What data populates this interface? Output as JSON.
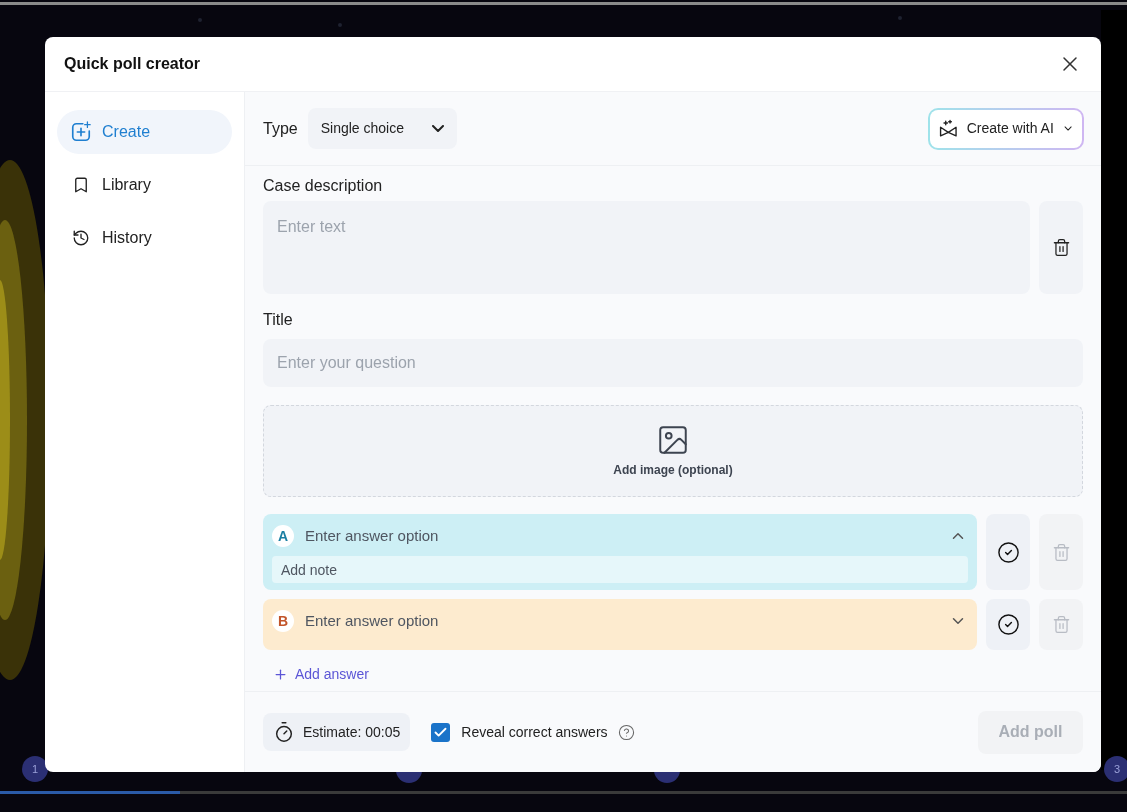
{
  "dialog": {
    "title": "Quick poll creator"
  },
  "sidebar": {
    "items": [
      {
        "kind": "create",
        "label": "Create",
        "selected": true
      },
      {
        "kind": "library",
        "label": "Library",
        "selected": false
      },
      {
        "kind": "history",
        "label": "History",
        "selected": false
      }
    ]
  },
  "type_field": {
    "label": "Type",
    "value": "Single choice"
  },
  "ai_button": {
    "label": "Create with AI"
  },
  "case_description": {
    "label": "Case description",
    "placeholder": "Enter text"
  },
  "title_field": {
    "label": "Title",
    "placeholder": "Enter your question"
  },
  "image_upload": {
    "label": "Add image (optional)"
  },
  "answers": [
    {
      "letter": "A",
      "placeholder": "Enter answer option",
      "expanded": true,
      "note_placeholder": "Add note",
      "color": "#cdeff5"
    },
    {
      "letter": "B",
      "placeholder": "Enter answer option",
      "expanded": false,
      "color": "#fdebcf"
    }
  ],
  "add_answer": {
    "label": "Add answer"
  },
  "footer": {
    "estimate": "Estimate: 00:05",
    "reveal": {
      "label": "Reveal correct answers",
      "checked": true
    },
    "add_poll": {
      "label": "Add poll",
      "disabled": true
    }
  },
  "timeline": {
    "level": 0.16,
    "markers": [
      "1",
      "3"
    ]
  }
}
